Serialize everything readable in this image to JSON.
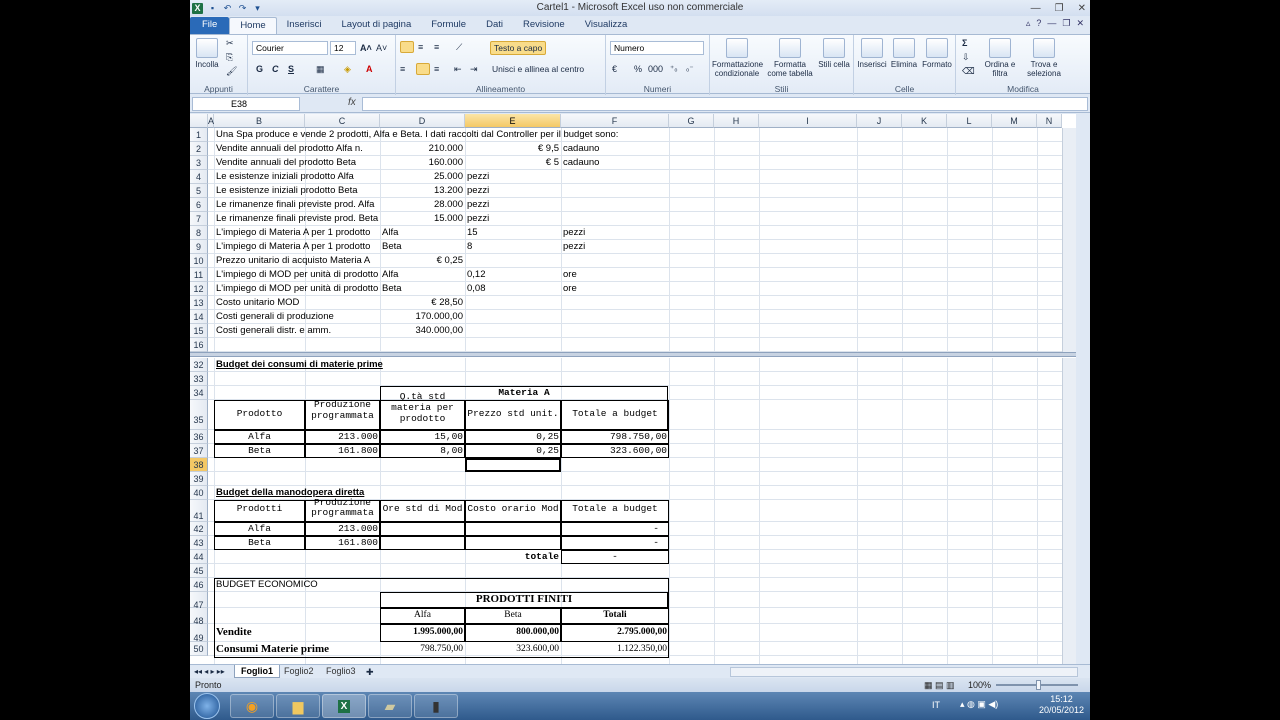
{
  "window": {
    "title": "Cartel1 - Microsoft Excel uso non commerciale"
  },
  "tabs": [
    "File",
    "Home",
    "Inserisci",
    "Layout di pagina",
    "Formule",
    "Dati",
    "Revisione",
    "Visualizza"
  ],
  "ribbon": {
    "clipboard": {
      "paste": "Incolla",
      "label": "Appunti"
    },
    "font": {
      "name": "Courier",
      "size": "12",
      "bold": "G",
      "italic": "C",
      "underline": "S",
      "label": "Carattere"
    },
    "alignment": {
      "wrap": "Testo a capo",
      "merge": "Unisci e allinea al centro",
      "label": "Allineamento"
    },
    "number": {
      "format": "Numero",
      "percent": "%",
      "thousands": "000",
      "label": "Numeri"
    },
    "styles": {
      "cond": "Formattazione condizionale",
      "table": "Formatta come tabella",
      "cell": "Stili cella",
      "label": "Stili"
    },
    "cells": {
      "insert": "Inserisci",
      "delete": "Elimina",
      "format": "Formato",
      "label": "Celle"
    },
    "editing": {
      "sort": "Ordina e filtra",
      "find": "Trova e seleziona",
      "label": "Modifica"
    }
  },
  "formula_bar": {
    "name_box": "E38",
    "fx": "fx",
    "value": ""
  },
  "columns": [
    "A",
    "B",
    "C",
    "D",
    "E",
    "G",
    "H",
    "I",
    "J",
    "K",
    "L",
    "M",
    "N"
  ],
  "rows_top": [
    {
      "n": "1",
      "b": "Una Spa produce e vende 2 prodotti, Alfa e Beta. I dati raccolti dal Controller per il budget sono:",
      "d": "",
      "e": "",
      "e2": "",
      "f": ""
    },
    {
      "n": "2",
      "b": "Vendite annuali del prodotto Alfa  n.",
      "d": "210.000",
      "e": "",
      "e2": "€ 9,5",
      "f": "cadauno"
    },
    {
      "n": "3",
      "b": "Vendite annuali del prodotto Beta",
      "d": "160.000",
      "e": "",
      "e2": "€ 5",
      "f": "cadauno"
    },
    {
      "n": "4",
      "b": "Le esistenze iniziali prodotto Alfa",
      "d": "25.000",
      "e": "pezzi",
      "e2": "",
      "f": ""
    },
    {
      "n": "5",
      "b": "Le esistenze iniziali prodotto Beta",
      "d": "13.200",
      "e": "pezzi",
      "e2": "",
      "f": ""
    },
    {
      "n": "6",
      "b": "Le rimanenze finali previste prod. Alfa",
      "d": "28.000",
      "e": "pezzi",
      "e2": "",
      "f": ""
    },
    {
      "n": "7",
      "b": "Le rimanenze finali previste prod. Beta",
      "d": "15.000",
      "e": "pezzi",
      "e2": "",
      "f": ""
    },
    {
      "n": "8",
      "b": "L'impiego di Materia A per 1 prodotto",
      "d": "Alfa",
      "e": "15",
      "e2": "",
      "f": "pezzi"
    },
    {
      "n": "9",
      "b": "L'impiego di Materia A per 1 prodotto",
      "d": "Beta",
      "e": "8",
      "e2": "",
      "f": "pezzi"
    },
    {
      "n": "10",
      "b": "Prezzo unitario di acquisto Materia A",
      "d": "€ 0,25",
      "e": "",
      "e2": "",
      "f": ""
    },
    {
      "n": "11",
      "b": "L'impiego di MOD per unità di prodotto",
      "d": "Alfa",
      "e": "0,12",
      "e2": "",
      "f": "ore"
    },
    {
      "n": "12",
      "b": "L'impiego di MOD per unità di prodotto",
      "d": "Beta",
      "e": "0,08",
      "e2": "",
      "f": "ore"
    },
    {
      "n": "13",
      "b": "Costo unitario MOD",
      "d": "€ 28,50",
      "e": "",
      "e2": "",
      "f": ""
    },
    {
      "n": "14",
      "b": "Costi generali di produzione",
      "d": "170.000,00",
      "e": "",
      "e2": "",
      "f": ""
    },
    {
      "n": "15",
      "b": "Costi generali distr. e amm.",
      "d": "340.000,00",
      "e": "",
      "e2": "",
      "f": ""
    },
    {
      "n": "16",
      "b": "",
      "d": "",
      "e": "",
      "e2": "",
      "f": ""
    }
  ],
  "section1": {
    "title": "Budget dei consumi di materie prime",
    "header_group": "Materia A",
    "headers": [
      "Prodotto",
      "Produzione programmata",
      "Q.tà std materia per prodotto",
      "Prezzo std unit.",
      "Totale a budget"
    ],
    "rows": [
      {
        "p": "Alfa",
        "prod": "213.000",
        "qta": "15,00",
        "prezzo": "0,25",
        "tot": "798.750,00"
      },
      {
        "p": "Beta",
        "prod": "161.800",
        "qta": "8,00",
        "prezzo": "0,25",
        "tot": "323.600,00"
      }
    ]
  },
  "section2": {
    "title": "Budget della manodopera diretta",
    "headers": [
      "Prodotti",
      "Produzione programmata",
      "Ore std di Mod",
      "Costo orario Mod",
      "Totale a budget"
    ],
    "rows": [
      {
        "p": "Alfa",
        "prod": "213.000",
        "tot": "-"
      },
      {
        "p": "Beta",
        "prod": "161.800",
        "tot": "-"
      }
    ],
    "total_label": "totale",
    "total_value": "-"
  },
  "section3": {
    "title": "BUDGET ECONOMICO",
    "group": "PRODOTTI FINITI",
    "headers": [
      "Alfa",
      "Beta",
      "Totali"
    ],
    "vendite": {
      "label": "Vendite",
      "alfa": "1.995.000,00",
      "beta": "800.000,00",
      "tot": "2.795.000,00"
    },
    "consumi": {
      "label": "Consumi Materie prime",
      "alfa": "798.750,00",
      "beta": "323.600,00",
      "tot": "1.122.350,00"
    }
  },
  "sheets": [
    "Foglio1",
    "Foglio2",
    "Foglio3"
  ],
  "status": {
    "ready": "Pronto",
    "zoom": "100%"
  },
  "tray": {
    "lang": "IT",
    "time": "15:12",
    "date": "20/05/2012"
  },
  "misc_row_numbers": [
    "32",
    "33",
    "34",
    "35",
    "36",
    "37",
    "38",
    "39",
    "40",
    "41",
    "42",
    "43",
    "44",
    "45",
    "46",
    "47",
    "48",
    "49",
    "50"
  ]
}
